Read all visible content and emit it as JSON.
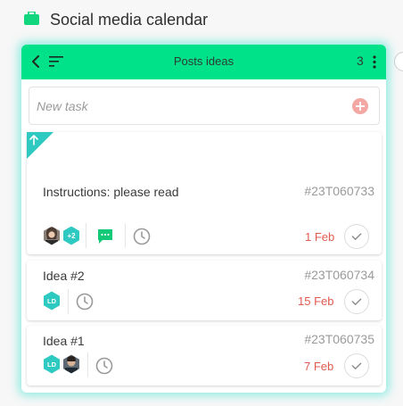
{
  "app": {
    "title": "Social media calendar"
  },
  "column": {
    "title": "Posts ideas",
    "count": "3",
    "header_color": "#00e28a"
  },
  "new_task": {
    "placeholder": "New task"
  },
  "cards": [
    {
      "title": "Instructions: please read",
      "id": "#23T060733",
      "due": "1 Feb",
      "avatars": [
        "photo",
        "+2"
      ],
      "has_comments": true,
      "priority": "up"
    },
    {
      "title": "Idea #2",
      "id": "#23T060734",
      "due": "15 Feb",
      "avatars": [
        "LD"
      ]
    },
    {
      "title": "Idea #1",
      "id": "#23T060735",
      "due": "7 Feb",
      "avatars": [
        "LD",
        "photo"
      ]
    }
  ],
  "colors": {
    "accent_green": "#00e28a",
    "teal": "#2ec9c0",
    "due_red": "#e05a4f",
    "glow": "#4fe4d4"
  }
}
